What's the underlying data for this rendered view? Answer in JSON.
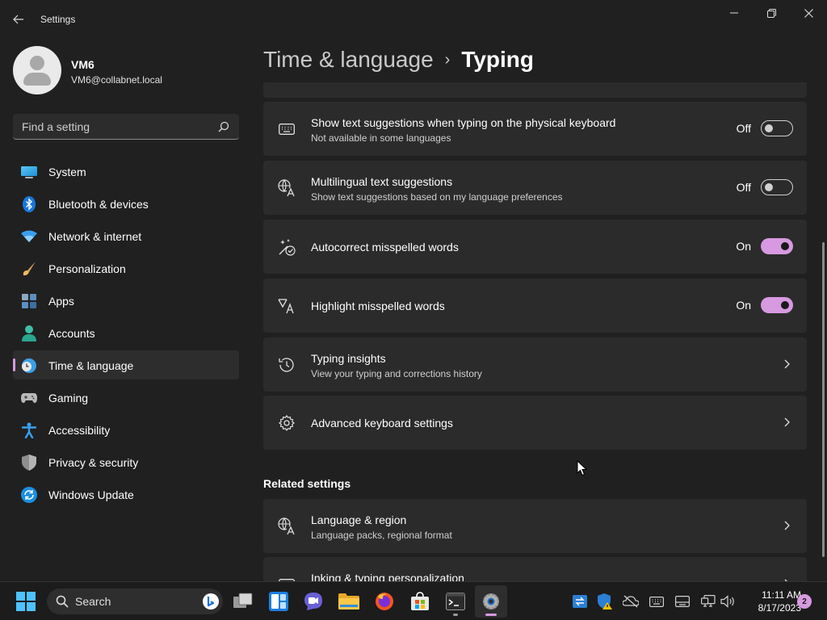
{
  "window": {
    "title": "Settings"
  },
  "profile": {
    "name": "VM6",
    "email": "VM6@collabnet.local"
  },
  "search": {
    "placeholder": "Find a setting"
  },
  "nav": {
    "items": [
      {
        "label": "System",
        "icon": "system-icon",
        "selected": false
      },
      {
        "label": "Bluetooth & devices",
        "icon": "bluetooth-icon",
        "selected": false
      },
      {
        "label": "Network & internet",
        "icon": "wifi-icon",
        "selected": false
      },
      {
        "label": "Personalization",
        "icon": "brush-icon",
        "selected": false
      },
      {
        "label": "Apps",
        "icon": "apps-icon",
        "selected": false
      },
      {
        "label": "Accounts",
        "icon": "accounts-icon",
        "selected": false
      },
      {
        "label": "Time & language",
        "icon": "clock-globe-icon",
        "selected": true
      },
      {
        "label": "Gaming",
        "icon": "gamepad-icon",
        "selected": false
      },
      {
        "label": "Accessibility",
        "icon": "accessibility-icon",
        "selected": false
      },
      {
        "label": "Privacy & security",
        "icon": "shield-icon",
        "selected": false
      },
      {
        "label": "Windows Update",
        "icon": "update-icon",
        "selected": false
      }
    ]
  },
  "breadcrumb": {
    "parent": "Time & language",
    "separator": "›",
    "current": "Typing"
  },
  "cards": {
    "text_suggestions": {
      "title": "Show text suggestions when typing on the physical keyboard",
      "subtitle": "Not available in some languages",
      "state": "Off",
      "on": false
    },
    "multilingual": {
      "title": "Multilingual text suggestions",
      "subtitle": "Show text suggestions based on my language preferences",
      "state": "Off",
      "on": false
    },
    "autocorrect": {
      "title": "Autocorrect misspelled words",
      "state": "On",
      "on": true
    },
    "highlight": {
      "title": "Highlight misspelled words",
      "state": "On",
      "on": true
    },
    "insights": {
      "title": "Typing insights",
      "subtitle": "View your typing and corrections history"
    },
    "advanced_keyboard": {
      "title": "Advanced keyboard settings"
    }
  },
  "related": {
    "header": "Related settings",
    "language_region": {
      "title": "Language & region",
      "subtitle": "Language packs, regional format"
    },
    "inking": {
      "title": "Inking & typing personalization"
    }
  },
  "taskbar": {
    "search_label": "Search",
    "time": "11:11 AM",
    "date": "8/17/2023",
    "notification_count": "2"
  },
  "colors": {
    "accent": "#d799e0",
    "background": "#202020",
    "card": "#2b2b2b"
  }
}
